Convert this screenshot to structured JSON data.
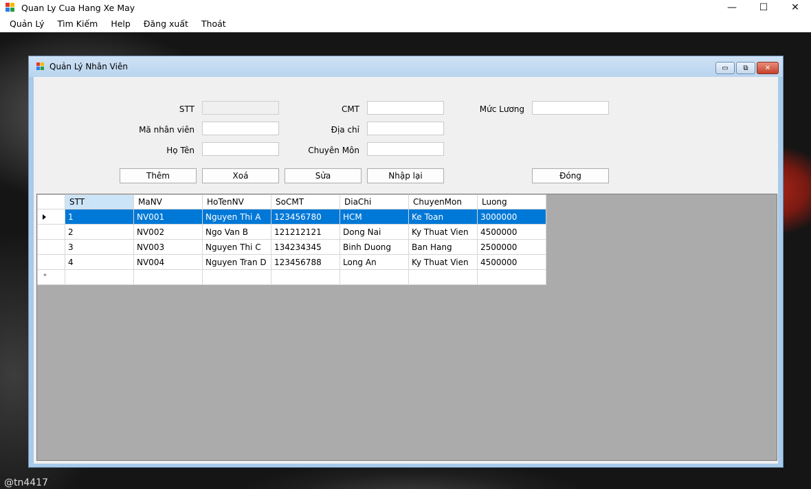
{
  "app": {
    "title": "Quan Ly Cua Hang Xe May",
    "controls": {
      "minimize": "—",
      "maximize": "☐",
      "close": "✕"
    }
  },
  "menu": [
    "Quản Lý",
    "Tìm Kiếm",
    "Help",
    "Đăng xuất",
    "Thoát"
  ],
  "child": {
    "title": "Quản Lý Nhân Viên",
    "controls": {
      "minimize": "▭",
      "restore": "⧉",
      "close": "✕"
    }
  },
  "form": {
    "labels": {
      "stt": "STT",
      "ma_nv": "Mã nhân viên",
      "ho_ten": "Họ Tên",
      "cmt": "CMT",
      "dia_chi": "Địa chỉ",
      "chuyen_mon": "Chuyên Môn",
      "muc_luong": "Mức Lương"
    },
    "values": {
      "stt": "",
      "ma_nv": "",
      "ho_ten": "",
      "cmt": "",
      "dia_chi": "",
      "chuyen_mon": "",
      "muc_luong": ""
    }
  },
  "buttons": {
    "them": "Thêm",
    "xoa": "Xoá",
    "sua": "Sửa",
    "nhap_lai": "Nhập lại",
    "dong": "Đóng"
  },
  "grid": {
    "columns": [
      "STT",
      "MaNV",
      "HoTenNV",
      "SoCMT",
      "DiaChi",
      "ChuyenMon",
      "Luong"
    ],
    "rows": [
      [
        "1",
        "NV001",
        "Nguyen Thi A",
        "123456780",
        "HCM",
        "Ke Toan",
        "3000000"
      ],
      [
        "2",
        "NV002",
        "Ngo Van B",
        "121212121",
        "Dong Nai",
        "Ky Thuat Vien",
        "4500000"
      ],
      [
        "3",
        "NV003",
        "Nguyen Thi C",
        "134234345",
        "Binh Duong",
        "Ban Hang",
        "2500000"
      ],
      [
        "4",
        "NV004",
        "Nguyen Tran D",
        "123456788",
        "Long An",
        "Ky Thuat Vien",
        "4500000"
      ]
    ],
    "selected_row": 0
  },
  "watermark": "@tn4417"
}
